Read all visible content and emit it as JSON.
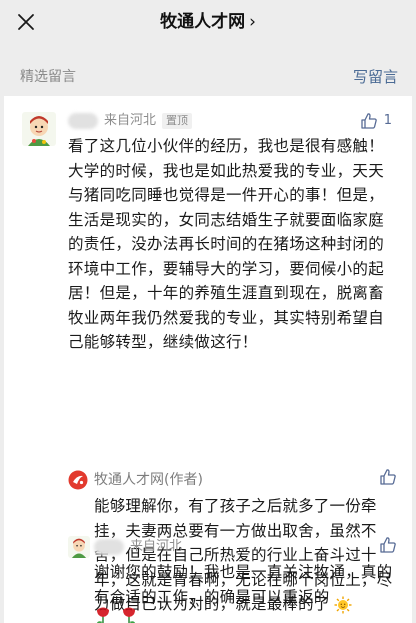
{
  "header": {
    "title": "牧通人才网",
    "chevron": "›"
  },
  "section": {
    "label": "精选留言",
    "write_label": "写留言"
  },
  "comment": {
    "origin": "来自河北",
    "badge": "置顶",
    "likes": "1",
    "text": "看了这几位小伙伴的经历，我也是很有感触！大学的时候，我也是如此热爱我的专业，天天与猪同吃同睡也觉得是一件开心的事！但是，生活是现实的，女同志结婚生子就要面临家庭的责任，没办法再长时间的在猪场这种封闭的环境中工作，要辅导大的学习，要伺候小的起居！但是，十年的养殖生涯直到现在，脱离畜牧业两年我仍然爱我的专业，其实特别希望自己能够转型，继续做这行！"
  },
  "reply": {
    "author": "牧通人才网(作者)",
    "text": "能够理解你，有了孩子之后就多了一份牵挂，夫妻两总要有一方做出取舍，虽然不舍，但是在自己所热爱的行业上奋斗过十年，这就是青春啊，无论在哪个岗位上，尽力做自己认为对的，就是最棒的了"
  },
  "reply2": {
    "origin": "来自河北",
    "text": "谢谢您的鼓励！我也是一直关注牧通，真的有合适的工作，的确是可以重返的"
  },
  "icons": [
    "close-icon",
    "thumb-up-icon",
    "sun-emoji-icon",
    "rose-emoji-icon",
    "author-logo-icon"
  ],
  "colors": {
    "link": "#576b95",
    "bg": "#ededed",
    "brand_red": "#e23a2e"
  }
}
